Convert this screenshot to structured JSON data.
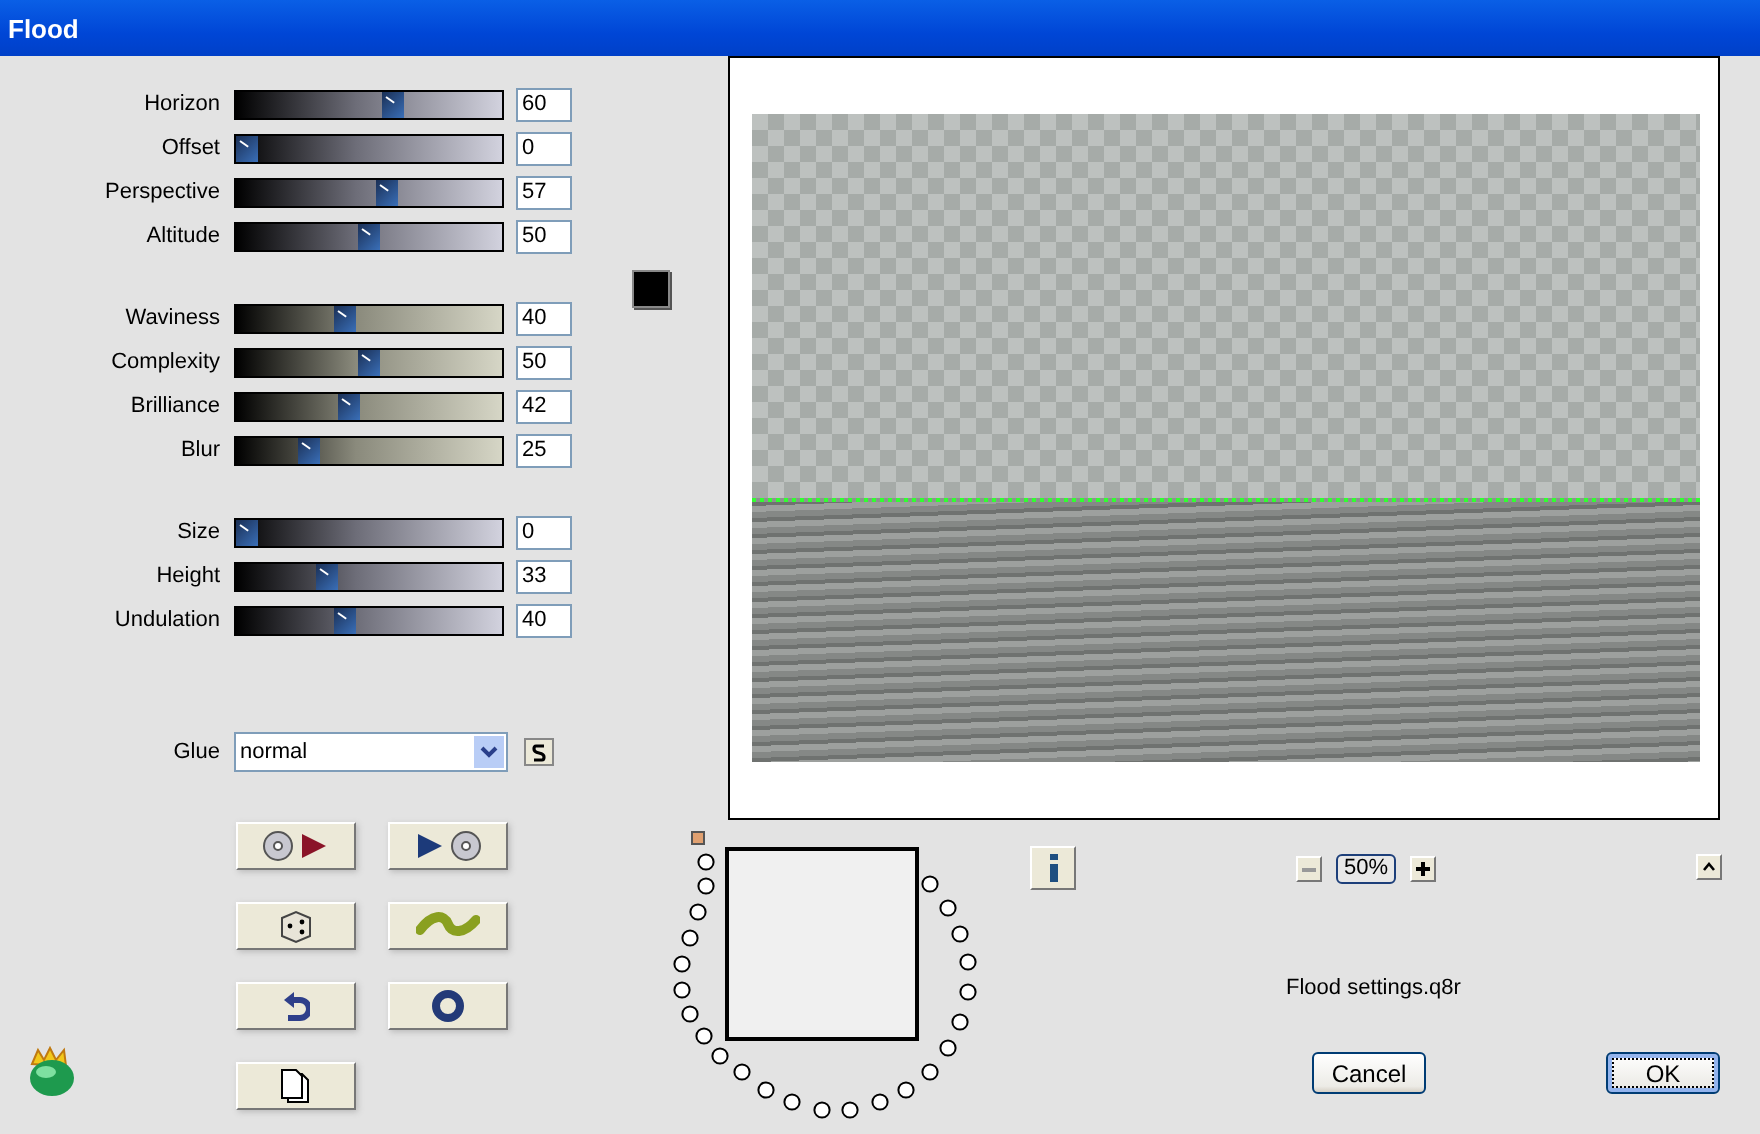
{
  "window": {
    "title": "Flood"
  },
  "slider_groups": [
    {
      "sliders": [
        {
          "label": "Horizon",
          "value": "60",
          "level": 0.6
        },
        {
          "label": "Offset",
          "value": "0",
          "level": 0
        },
        {
          "label": "Perspective",
          "value": "57",
          "level": 0.57
        },
        {
          "label": "Altitude",
          "value": "50",
          "level": 0.5
        }
      ]
    },
    {
      "sliders": [
        {
          "label": "Waviness",
          "value": "40",
          "level": 0.4
        },
        {
          "label": "Complexity",
          "value": "50",
          "level": 0.5
        },
        {
          "label": "Brilliance",
          "value": "42",
          "level": 0.42
        },
        {
          "label": "Blur",
          "value": "25",
          "level": 0.25
        }
      ]
    },
    {
      "sliders": [
        {
          "label": "Size",
          "value": "0",
          "level": 0
        },
        {
          "label": "Height",
          "value": "33",
          "level": 0.33
        },
        {
          "label": "Undulation",
          "value": "40",
          "level": 0.4
        }
      ]
    }
  ],
  "glue": {
    "label": "Glue",
    "value": "normal"
  },
  "tool_buttons": [
    {
      "kind": "disc-arrow"
    },
    {
      "kind": "arrow-disc"
    },
    {
      "kind": "dice"
    },
    {
      "kind": "wave"
    },
    {
      "kind": "undo"
    },
    {
      "kind": "ring"
    },
    {
      "kind": "page"
    }
  ],
  "zoom": {
    "value": "50%"
  },
  "file_name": "Flood settings.q8r",
  "buttons": [
    {
      "label": "Cancel",
      "default": false
    },
    {
      "label": "OK",
      "default": true
    }
  ]
}
